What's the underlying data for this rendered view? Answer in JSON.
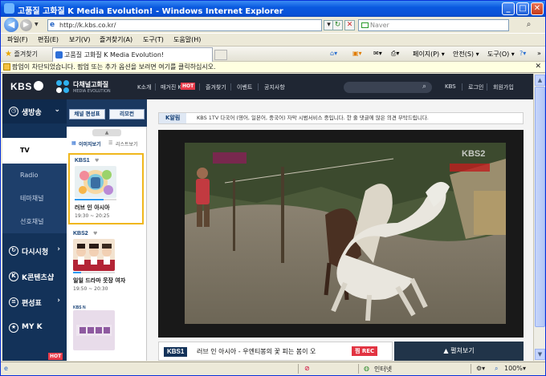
{
  "window": {
    "title": "고품질 고화질 K Media Evolution! - Windows Internet Explorer",
    "min": "_",
    "max": "□",
    "close": "✕"
  },
  "address": {
    "url": "http://k.kbs.co.kr/",
    "search_placeholder": "Naver"
  },
  "menu": [
    "파일(F)",
    "편집(E)",
    "보기(V)",
    "즐겨찾기(A)",
    "도구(T)",
    "도움말(H)"
  ],
  "favorites_label": "즐겨찾기",
  "tab_title": "고품질 고화질 K Media Evolution!",
  "commands": [
    "페이지(P) ▾",
    "안전(S) ▾",
    "도구(O) ▾"
  ],
  "infobar": "팝업이 차단되었습니다. 팝업 또는 추가 옵션을 보려면 여기를 클릭하십시오.",
  "header": {
    "logo": "KBS",
    "brand_title": "다채널고화질",
    "brand_sub": "MEDIA EVOLUTION",
    "nav": [
      "K소개",
      "매거진 K",
      "즐겨찾기",
      "이벤트",
      "공지사항"
    ],
    "hot": "HOT",
    "right": [
      "KBS",
      "로그인",
      "회원가입"
    ]
  },
  "leftnav": {
    "live": "생방송",
    "sub": [
      "TV",
      "Radio",
      "테마채널",
      "선호채널"
    ],
    "items": [
      "다시시청",
      "K콘텐츠샵",
      "편성표",
      "MY K"
    ],
    "hot": "HOT"
  },
  "schedule": {
    "buttons": [
      "채널 편성표",
      "리모컨"
    ],
    "views": [
      "이미지보기",
      "리스트보기"
    ],
    "cards": [
      {
        "channel": "KBS1",
        "program": "러브 인 아시아",
        "time": "19:30 ~ 20:25",
        "progress": 0.7
      },
      {
        "channel": "KBS2",
        "program": "일일 드라마 웃장 여자",
        "time": "19:50 ~ 20:30",
        "progress": 0.2
      },
      {
        "channel": "KBS N",
        "program": "",
        "time": "",
        "progress": 0
      }
    ]
  },
  "player": {
    "alert_tag": "K알림",
    "alert_msg": "KBS 1TV 다국어 (영어, 일본어, 중국어) 자막 시범서비스 중입니다. 한 줄 댓글에 많은 의견 부탁드립니다.",
    "watermark": "KBS2",
    "now_channel": "KBS1",
    "now_title": "러브 인 아시아 - 우엔티봉의 꽃 피는 봄이 오",
    "rec_label": "찜 REC",
    "expand_label": "▲ 펼쳐보기"
  },
  "status": {
    "internet": "인터넷",
    "zoom": "100%"
  },
  "colors": {
    "header_bg": "#1f2633",
    "nav_bg": "#133259",
    "accent_hot": "#e83b4a",
    "selected_card": "#f0b71c"
  }
}
